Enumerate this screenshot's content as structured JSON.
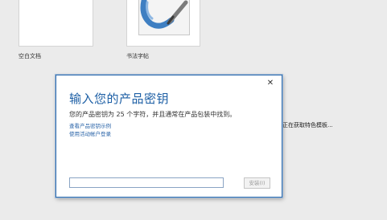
{
  "templates": {
    "blank_label": "空白文档",
    "calligraphy_label": "书法字帖"
  },
  "status": {
    "text": "正在获取特色模板..."
  },
  "dialog": {
    "title": "输入您的产品密钥",
    "description": "您的产品密钥为 25 个字符，并且通常在产品包装中找到。",
    "link_examples": "查看产品密钥示例",
    "link_account": "使用活动帐户登录",
    "key_input_value": "",
    "key_input_placeholder": "",
    "install_button": "安装(I)",
    "close_glyph": "✕"
  },
  "colors": {
    "title_blue": "#1d5fa5",
    "link_blue": "#2a64a8",
    "dialog_border": "#2f6cae"
  }
}
